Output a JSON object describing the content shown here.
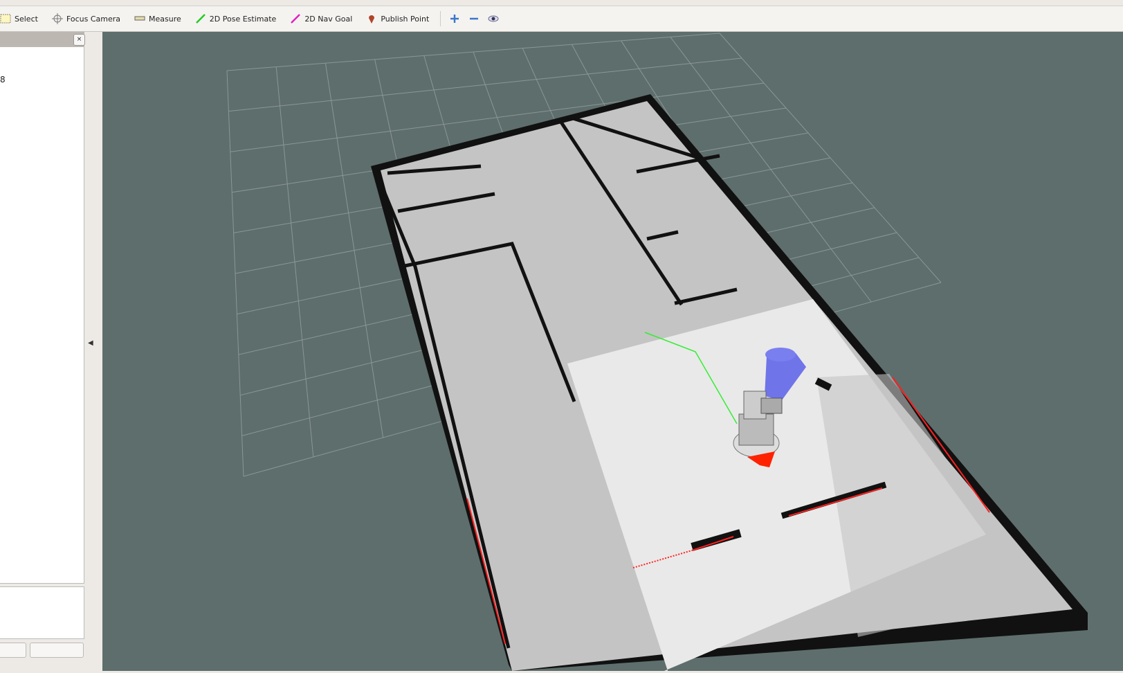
{
  "toolbar": {
    "tools": [
      {
        "label": "Select",
        "icon": "select-icon"
      },
      {
        "label": "Focus Camera",
        "icon": "focus-camera-icon"
      },
      {
        "label": "Measure",
        "icon": "ruler-icon"
      },
      {
        "label": "2D Pose Estimate",
        "icon": "green-arrow-icon"
      },
      {
        "label": "2D Nav Goal",
        "icon": "magenta-arrow-icon"
      },
      {
        "label": "Publish Point",
        "icon": "map-pin-icon"
      }
    ],
    "extra": [
      "plus-icon",
      "minus-icon",
      "eye-icon"
    ]
  },
  "panel": {
    "close": "×",
    "value": "8"
  },
  "colors": {
    "background": "#5e6e6c",
    "grid": "#8a9896",
    "map_free": "#c4c4c4",
    "map_explored": "#e9e9e9",
    "wall": "#111111",
    "path": "#33ee33",
    "laser": "#ff2200",
    "camera_cone": "#6f74e8"
  }
}
